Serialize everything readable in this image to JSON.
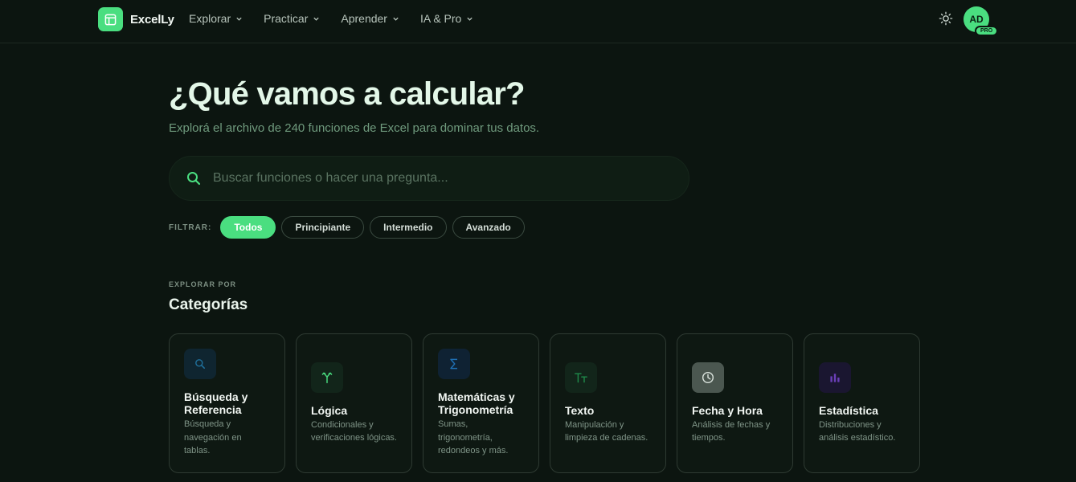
{
  "header": {
    "logo_text": "ExcelLy",
    "nav": [
      {
        "label": "Explorar"
      },
      {
        "label": "Practicar"
      },
      {
        "label": "Aprender"
      },
      {
        "label": "IA & Pro"
      }
    ],
    "theme_icon": "sun-icon",
    "avatar_initials": "AD",
    "pro_badge": "PRO"
  },
  "hero": {
    "title": "¿Qué vamos a calcular?",
    "subtitle": "Explorá el archivo de 240 funciones de Excel para dominar tus datos.",
    "search_placeholder": "Buscar funciones o hacer una pregunta...",
    "search_value": ""
  },
  "filters": {
    "label": "FILTRAR:",
    "chips": [
      {
        "label": "Todos",
        "active": true
      },
      {
        "label": "Principiante",
        "active": false
      },
      {
        "label": "Intermedio",
        "active": false
      },
      {
        "label": "Avanzado",
        "active": false
      }
    ]
  },
  "categories": {
    "kicker": "EXPLORAR POR",
    "title": "Categorías",
    "items": [
      {
        "title": "Búsqueda y Referencia",
        "desc": "Búsqueda y navegación en tablas.",
        "icon": "search-icon",
        "icon_color": "#1f6f9a",
        "icon_bg": "#0f2530"
      },
      {
        "title": "Lógica",
        "desc": "Condicionales y verificaciones lógicas.",
        "icon": "branch-icon",
        "icon_color": "#4ade80",
        "icon_bg": "#12251a"
      },
      {
        "title": "Matemáticas y Trigonometría",
        "desc": "Sumas, trigonometría, redondeos y más.",
        "icon": "sigma-icon",
        "icon_color": "#1f6fb3",
        "icon_bg": "#0f2233"
      },
      {
        "title": "Texto",
        "desc": "Manipulación y limpieza de cadenas.",
        "icon": "text-icon",
        "icon_color": "#1f8a4a",
        "icon_bg": "#12251a"
      },
      {
        "title": "Fecha y Hora",
        "desc": "Análisis de fechas y tiempos.",
        "icon": "clock-icon",
        "icon_color": "#d9e2dc",
        "icon_bg": "#4b5750"
      },
      {
        "title": "Estadística",
        "desc": "Distribuciones y análisis estadístico.",
        "icon": "bar-chart-icon",
        "icon_color": "#6b3fb8",
        "icon_bg": "#1a1630"
      }
    ]
  }
}
